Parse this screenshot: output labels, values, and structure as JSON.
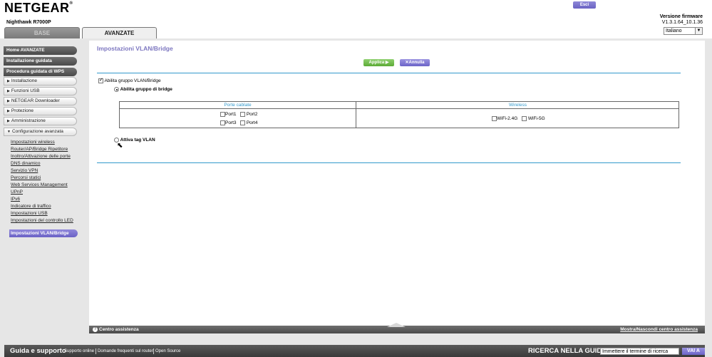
{
  "header": {
    "brand": "NETGEAR",
    "brand_mark": "®",
    "model": "Nighthawk R7000P",
    "logout": "Esci",
    "firmware_label": "Versione firmware",
    "firmware_version": "V1.3.1.64_10.1.36",
    "language": "Italiano"
  },
  "tabs": {
    "basic": "BASE",
    "advanced": "AVANZATE"
  },
  "sidebar": {
    "home": "Home AVANZATE",
    "setup_wizard": "Installazione guidata",
    "wps_wizard": "Procedura guidata di WPS",
    "sections": [
      "Installazione",
      "Funzioni USB",
      "NETGEAR Downloader",
      "Protezione",
      "Amministrazione",
      "Configurazione avanzata"
    ],
    "links": [
      "Impostazioni wireless",
      "Router/AP/Bridge Ripetitore",
      "Inoltro/Attivazione delle porte",
      "DNS dinamico",
      "Servizio VPN",
      "Percorsi statici",
      "Web Services Management",
      "UPnP",
      "IPv6",
      "Indicatore di traffico",
      "Impostazioni USB",
      "Impostazioni del controllo LED",
      "Impostazioni VLAN/Bridge"
    ]
  },
  "main": {
    "title": "Impostazioni VLAN/Bridge",
    "apply": "Applica",
    "cancel": "Annulla",
    "enable_group": "Abilita gruppo VLAN/Bridge",
    "bridge_group": "Abilita gruppo di bridge",
    "vlan_tag": "Attiva tag VLAN",
    "table": {
      "wired_header": "Porte cablate",
      "wireless_header": "Wireless",
      "ports": [
        "Port1",
        "Port2",
        "Port3",
        "Port4"
      ],
      "wifi": [
        "WiFi-2.4G",
        "WiFi-5G"
      ]
    }
  },
  "helpbar": {
    "help_center": "Centro assistenza",
    "toggle": "Mostra/Nascondi centro assistenza"
  },
  "footer": {
    "guide": "Guida e supporto",
    "links": [
      "Supporto online",
      "Domande frequenti sul router",
      "Open Source"
    ],
    "search_label": "RICERCA NELLA GUIDA",
    "search_placeholder": "Immettere il termine di ricerca",
    "go": "VAI A"
  },
  "colors": {
    "accent": "#3399cc",
    "title": "#7d77c0",
    "button_purple": "#6c64c8",
    "button_green": "#5caa36"
  }
}
